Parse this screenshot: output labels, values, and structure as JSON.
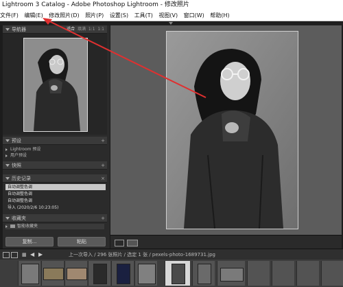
{
  "window": {
    "title": "Lightroom 3 Catalog - Adobe Photoshop Lightroom - 修改照片"
  },
  "menu": {
    "items": [
      "文件(F)",
      "编辑(E)",
      "修改照片(D)",
      "照片(P)",
      "设置(S)",
      "工具(T)",
      "视图(V)",
      "窗口(W)",
      "帮助(H)"
    ]
  },
  "navigator": {
    "title": "导航器",
    "options": [
      "适合",
      "填满",
      "1:1",
      "1:1"
    ]
  },
  "presets": {
    "title": "预设",
    "items": [
      "Lightroom 预设",
      "用户预设"
    ]
  },
  "snapshots": {
    "title": "快照"
  },
  "history": {
    "title": "历史记录",
    "items": [
      "自动调整色调",
      "自动调整色调",
      "自动调整色调",
      "导入 (2020/2/6 10:23:05)"
    ]
  },
  "collections": {
    "title": "收藏夹",
    "items": [
      "智能收藏夹"
    ]
  },
  "buttons": {
    "copy": "复制...",
    "paste": "粘贴"
  },
  "filmstrip": {
    "nav_text": "上一次导入 / 296 张照片 / 选定 1 张 / pexels-photo-1689731.jpg",
    "page_numbers": [
      "1",
      "2"
    ]
  },
  "colors": {
    "accent_arrow": "#e03030",
    "panel_bg": "#2b2b2b",
    "canvas_bg": "#5c5c5c"
  }
}
